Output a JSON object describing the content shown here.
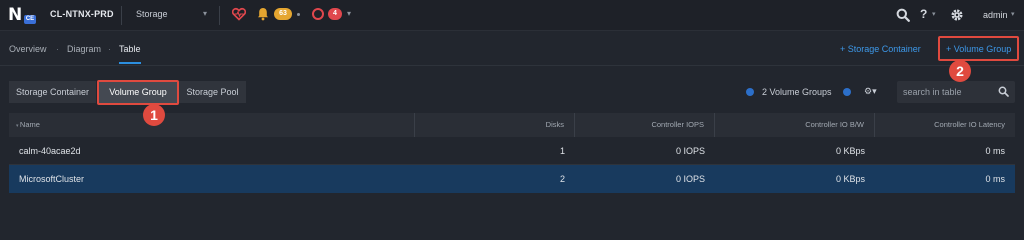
{
  "topbar": {
    "cluster_name": "CL-NTNX-PRD",
    "entity_menu": "Storage",
    "warning_count": "63",
    "critical_count": "4",
    "help_label": "?",
    "user": "admin",
    "logo_badge": "CE"
  },
  "subnav": {
    "tabs": [
      {
        "label": "Overview"
      },
      {
        "label": "Diagram"
      },
      {
        "label": "Table"
      }
    ],
    "separator": "·",
    "add_storage_container": "+ Storage Container",
    "add_volume_group": "+ Volume Group"
  },
  "segments": [
    {
      "label": "Storage Container"
    },
    {
      "label": "Volume Group"
    },
    {
      "label": "Storage Pool"
    }
  ],
  "toolbar": {
    "count_label": "2 Volume Groups",
    "search_placeholder": "search in table"
  },
  "table": {
    "columns": [
      "Name",
      "Disks",
      "Controller IOPS",
      "Controller IO B/W",
      "Controller IO Latency"
    ],
    "rows": [
      {
        "name": "calm-40acae2d",
        "disks": "1",
        "iops": "0 IOPS",
        "bw": "0 KBps",
        "latency": "0 ms"
      },
      {
        "name": "MicrosoftCluster",
        "disks": "2",
        "iops": "0 IOPS",
        "bw": "0 KBps",
        "latency": "0 ms"
      }
    ]
  },
  "annotations": [
    {
      "number": "1"
    },
    {
      "number": "2"
    }
  ],
  "colors": {
    "accent": "#3d98e8",
    "selected_row": "#183a5e",
    "highlight": "#e04a3f",
    "warning": "#e5a630",
    "critical": "#e0474d"
  }
}
